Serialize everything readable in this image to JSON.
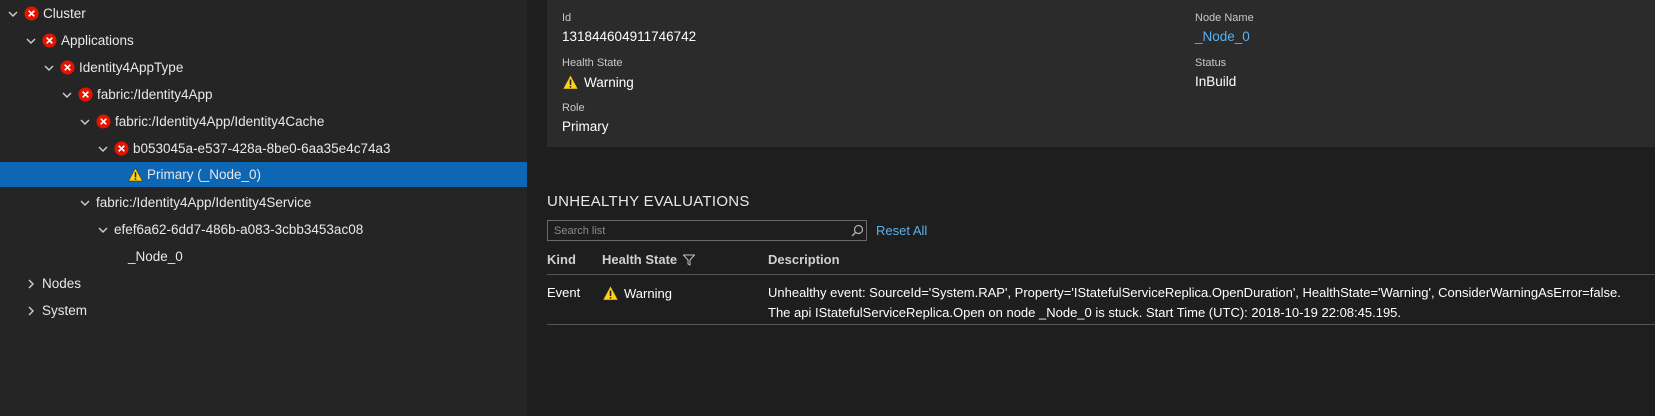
{
  "tree": {
    "items": [
      {
        "label": "Cluster",
        "expanded": true,
        "status": "error",
        "indent": 0
      },
      {
        "label": "Applications",
        "expanded": true,
        "status": "error",
        "indent": 1
      },
      {
        "label": "Identity4AppType",
        "expanded": true,
        "status": "error",
        "indent": 2
      },
      {
        "label": "fabric:/Identity4App",
        "expanded": true,
        "status": "error",
        "indent": 3
      },
      {
        "label": "fabric:/Identity4App/Identity4Cache",
        "expanded": true,
        "status": "error",
        "indent": 4
      },
      {
        "label": "b053045a-e537-428a-8be0-6aa35e4c74a3",
        "expanded": true,
        "status": "error",
        "indent": 5
      },
      {
        "label": "Primary (_Node_0)",
        "expanded": null,
        "status": "warning",
        "indent": 6,
        "selected": true
      },
      {
        "label": "fabric:/Identity4App/Identity4Service",
        "expanded": true,
        "status": "none",
        "indent": 4
      },
      {
        "label": "efef6a62-6dd7-486b-a083-3cbb3453ac08",
        "expanded": true,
        "status": "none",
        "indent": 5
      },
      {
        "label": "_Node_0",
        "expanded": null,
        "status": "none",
        "indent": 6
      },
      {
        "label": "Nodes",
        "expanded": false,
        "status": "none",
        "indent": 1
      },
      {
        "label": "System",
        "expanded": false,
        "status": "none",
        "indent": 1
      }
    ]
  },
  "details": {
    "id_label": "Id",
    "id_value": "131844604911746742",
    "health_label": "Health State",
    "health_value": "Warning",
    "role_label": "Role",
    "role_value": "Primary",
    "node_name_label": "Node Name",
    "node_name_value": "_Node_0",
    "status_label": "Status",
    "status_value": "InBuild"
  },
  "evaluations": {
    "title": "UNHEALTHY EVALUATIONS",
    "search_placeholder": "Search list",
    "reset_all": "Reset All",
    "columns": {
      "kind": "Kind",
      "health": "Health State",
      "description": "Description"
    },
    "rows": [
      {
        "kind": "Event",
        "health": "Warning",
        "description_line1": "Unhealthy event: SourceId='System.RAP', Property='IStatefulServiceReplica.OpenDuration', HealthState='Warning', ConsiderWarningAsError=false.",
        "description_line2": "The api IStatefulServiceReplica.Open on node _Node_0 is stuck. Start Time (UTC): 2018-10-19 22:08:45.195."
      }
    ]
  },
  "colors": {
    "accent": "#5ab1ef",
    "selection": "#0e67b5",
    "error": "#e51400",
    "warning": "#fcd116"
  }
}
